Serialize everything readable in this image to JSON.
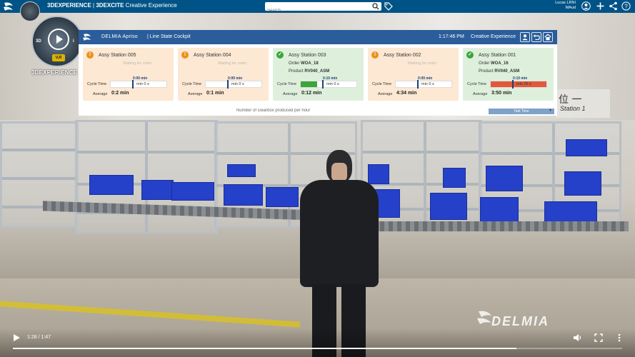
{
  "topbar": {
    "brand_bold": "3DEXPERIENCE",
    "brand_sep": " | ",
    "brand_app": "3DEXCITE",
    "brand_suffix": " Creative Experience",
    "search_placeholder": "Search",
    "user_name": "Lucas LRNI",
    "user_role": "MAud"
  },
  "compass": {
    "label_3d": "3D",
    "label_vr": "V,R",
    "brand": "3DEXPERIENCE"
  },
  "cockpit": {
    "app_name": "DELMIA Apriso",
    "page_title": "| Line State Cockpit",
    "time": "1:17:46 PM",
    "experience": "Creative Experience",
    "footer_text": "Number of Gearbox produced per hour",
    "footer_button": "Takt Time",
    "stations": [
      {
        "name": "Assy Station 005",
        "state": "waiting",
        "waiting_text": "Waiting for order",
        "order_label": "",
        "order": "",
        "product_label": "",
        "product": "",
        "cycle_label": "Cycle Time",
        "cycle_top": "0:00 min",
        "cycle_value": "min 0 s",
        "cycle_fill": 0,
        "average_label": "Average",
        "average": "0:2 min"
      },
      {
        "name": "Assy Station 004",
        "state": "waiting",
        "waiting_text": "Waiting for order",
        "order_label": "",
        "order": "",
        "product_label": "",
        "product": "",
        "cycle_label": "Cycle Time",
        "cycle_top": "0:00 min",
        "cycle_value": "min 0 s",
        "cycle_fill": 0,
        "average_label": "Average",
        "average": "0:1 min"
      },
      {
        "name": "Assy Station 003",
        "state": "active",
        "waiting_text": "",
        "order_label": "Order",
        "order": "WOA_18",
        "product_label": "Product",
        "product": "RV040_ASM",
        "cycle_label": "Cycle Time",
        "cycle_top": "0:10 min",
        "cycle_value": "min 0 s",
        "cycle_fill": 0.3,
        "average_label": "Average",
        "average": "0:12 min"
      },
      {
        "name": "Assy Station 002",
        "state": "waiting",
        "waiting_text": "Waiting for order",
        "order_label": "",
        "order": "",
        "product_label": "",
        "product": "",
        "cycle_label": "Cycle Time",
        "cycle_top": "0:00 min",
        "cycle_value": "min 0 s",
        "cycle_fill": 0,
        "average_label": "Average",
        "average": "4:34 min"
      },
      {
        "name": "Assy Station 001",
        "state": "active",
        "waiting_text": "",
        "order_label": "Order",
        "order": "WOA_16",
        "product_label": "Product",
        "product": "RV040_ASM",
        "cycle_label": "Cycle Time",
        "cycle_top": "0:10 min",
        "cycle_value": "min 26 s",
        "cycle_fill": 1.0,
        "average_label": "Average",
        "average": "3:50 min"
      }
    ]
  },
  "scene": {
    "sign_cn": "位 一",
    "sign_station": "Station 1",
    "watermark": "DELMIA"
  },
  "video": {
    "time": "1:28 / 1:47",
    "progress": 0.826
  },
  "colors": {
    "topbar": "#005386",
    "cockpit_header": "#2a5d9a",
    "waiting": "#e8921e",
    "active": "#3aa63a",
    "overrun": "#e05a3a",
    "bin_blue": "#2540c9"
  }
}
